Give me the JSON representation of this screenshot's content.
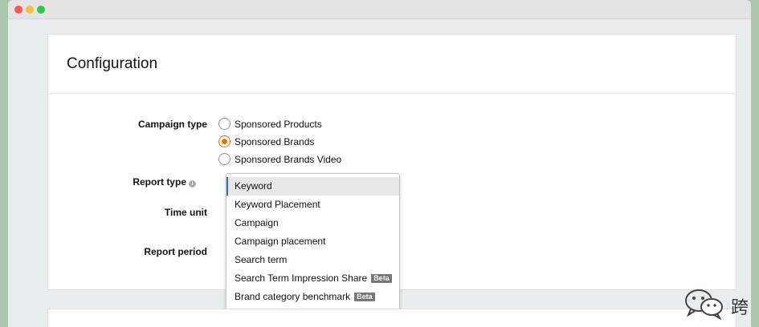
{
  "config": {
    "title": "Configuration",
    "campaign_type": {
      "label": "Campaign type",
      "options": [
        {
          "label": "Sponsored Products",
          "checked": false
        },
        {
          "label": "Sponsored Brands",
          "checked": true
        },
        {
          "label": "Sponsored Brands Video",
          "checked": false
        }
      ]
    },
    "report_type": {
      "label": "Report type",
      "info_icon": "i",
      "options": [
        {
          "label": "Keyword",
          "selected": true,
          "badge": ""
        },
        {
          "label": "Keyword Placement",
          "selected": false,
          "badge": ""
        },
        {
          "label": "Campaign",
          "selected": false,
          "badge": ""
        },
        {
          "label": "Campaign placement",
          "selected": false,
          "badge": ""
        },
        {
          "label": "Search term",
          "selected": false,
          "badge": ""
        },
        {
          "label": "Search Term Impression Share",
          "selected": false,
          "badge": "Beta"
        },
        {
          "label": "Brand category benchmark",
          "selected": false,
          "badge": "Beta"
        }
      ]
    },
    "time_unit": {
      "label": "Time unit"
    },
    "report_period": {
      "label": "Report period"
    }
  },
  "watermark": {
    "text": "跨",
    "icon": "wechat-icon"
  },
  "colors": {
    "accent": "#e77600",
    "selected_bar": "#3d6e9e",
    "background": "#a9c7a9"
  }
}
